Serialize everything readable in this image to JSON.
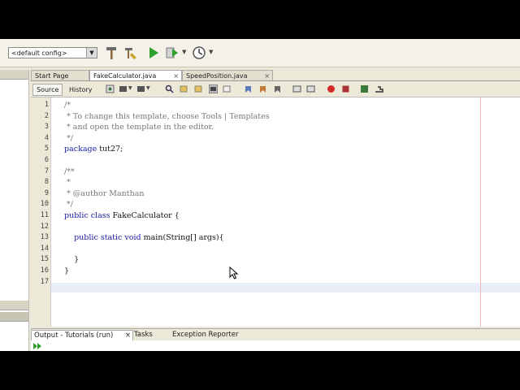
{
  "toolbar": {
    "config_value": "<default config>",
    "icons": [
      "hammer-icon",
      "clean-build-icon",
      "run-icon",
      "debug-icon",
      "profile-icon"
    ]
  },
  "editor_tabs": [
    {
      "label": "Start Page"
    },
    {
      "label": "FakeCalculator.java",
      "close": "×"
    },
    {
      "label": "SpeedPosition.java",
      "close": "×"
    }
  ],
  "editor_toolbar": {
    "source_label": "Source",
    "history_label": "History"
  },
  "code_lines": [
    {
      "n": "1",
      "text": "/*"
    },
    {
      "n": "2",
      "text": " * To change this template, choose Tools | Templates"
    },
    {
      "n": "3",
      "text": " * and open the template in the editor."
    },
    {
      "n": "4",
      "text": " */"
    },
    {
      "n": "5",
      "text": "package tut27;"
    },
    {
      "n": "6",
      "text": ""
    },
    {
      "n": "7",
      "text": "/**"
    },
    {
      "n": "8",
      "text": " *"
    },
    {
      "n": "9",
      "text": " * @author Manthan"
    },
    {
      "n": "10",
      "text": " */"
    },
    {
      "n": "11",
      "text": "public class FakeCalculator {"
    },
    {
      "n": "12",
      "text": ""
    },
    {
      "n": "13",
      "text": "    public static void main(String[] args){"
    },
    {
      "n": "14",
      "text": ""
    },
    {
      "n": "15",
      "text": "    }"
    },
    {
      "n": "16",
      "text": "}"
    },
    {
      "n": "17",
      "text": ""
    }
  ],
  "bottom_tabs": [
    {
      "label": "Output - Tutorials (run)",
      "close": "×"
    },
    {
      "label": "Tasks"
    },
    {
      "label": "Exception Reporter"
    }
  ]
}
